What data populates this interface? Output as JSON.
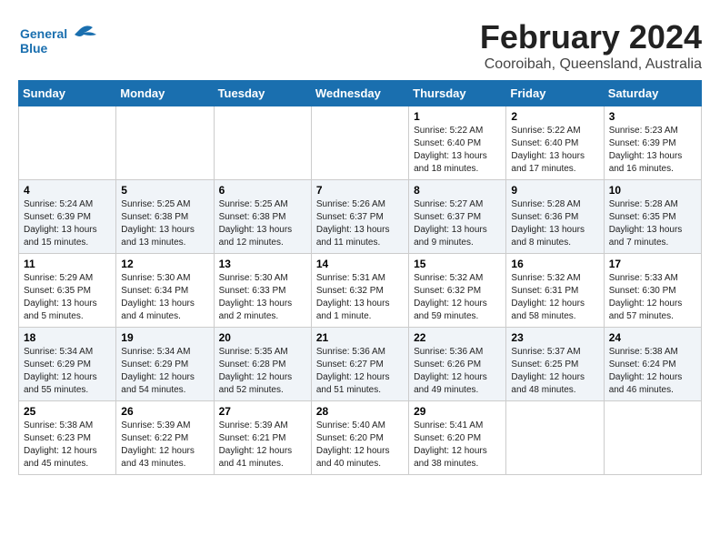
{
  "logo": {
    "line1": "General",
    "line2": "Blue"
  },
  "title": "February 2024",
  "subtitle": "Cooroibah, Queensland, Australia",
  "days_of_week": [
    "Sunday",
    "Monday",
    "Tuesday",
    "Wednesday",
    "Thursday",
    "Friday",
    "Saturday"
  ],
  "weeks": [
    [
      {
        "day": "",
        "detail": ""
      },
      {
        "day": "",
        "detail": ""
      },
      {
        "day": "",
        "detail": ""
      },
      {
        "day": "",
        "detail": ""
      },
      {
        "day": "1",
        "detail": "Sunrise: 5:22 AM\nSunset: 6:40 PM\nDaylight: 13 hours\nand 18 minutes."
      },
      {
        "day": "2",
        "detail": "Sunrise: 5:22 AM\nSunset: 6:40 PM\nDaylight: 13 hours\nand 17 minutes."
      },
      {
        "day": "3",
        "detail": "Sunrise: 5:23 AM\nSunset: 6:39 PM\nDaylight: 13 hours\nand 16 minutes."
      }
    ],
    [
      {
        "day": "4",
        "detail": "Sunrise: 5:24 AM\nSunset: 6:39 PM\nDaylight: 13 hours\nand 15 minutes."
      },
      {
        "day": "5",
        "detail": "Sunrise: 5:25 AM\nSunset: 6:38 PM\nDaylight: 13 hours\nand 13 minutes."
      },
      {
        "day": "6",
        "detail": "Sunrise: 5:25 AM\nSunset: 6:38 PM\nDaylight: 13 hours\nand 12 minutes."
      },
      {
        "day": "7",
        "detail": "Sunrise: 5:26 AM\nSunset: 6:37 PM\nDaylight: 13 hours\nand 11 minutes."
      },
      {
        "day": "8",
        "detail": "Sunrise: 5:27 AM\nSunset: 6:37 PM\nDaylight: 13 hours\nand 9 minutes."
      },
      {
        "day": "9",
        "detail": "Sunrise: 5:28 AM\nSunset: 6:36 PM\nDaylight: 13 hours\nand 8 minutes."
      },
      {
        "day": "10",
        "detail": "Sunrise: 5:28 AM\nSunset: 6:35 PM\nDaylight: 13 hours\nand 7 minutes."
      }
    ],
    [
      {
        "day": "11",
        "detail": "Sunrise: 5:29 AM\nSunset: 6:35 PM\nDaylight: 13 hours\nand 5 minutes."
      },
      {
        "day": "12",
        "detail": "Sunrise: 5:30 AM\nSunset: 6:34 PM\nDaylight: 13 hours\nand 4 minutes."
      },
      {
        "day": "13",
        "detail": "Sunrise: 5:30 AM\nSunset: 6:33 PM\nDaylight: 13 hours\nand 2 minutes."
      },
      {
        "day": "14",
        "detail": "Sunrise: 5:31 AM\nSunset: 6:32 PM\nDaylight: 13 hours\nand 1 minute."
      },
      {
        "day": "15",
        "detail": "Sunrise: 5:32 AM\nSunset: 6:32 PM\nDaylight: 12 hours\nand 59 minutes."
      },
      {
        "day": "16",
        "detail": "Sunrise: 5:32 AM\nSunset: 6:31 PM\nDaylight: 12 hours\nand 58 minutes."
      },
      {
        "day": "17",
        "detail": "Sunrise: 5:33 AM\nSunset: 6:30 PM\nDaylight: 12 hours\nand 57 minutes."
      }
    ],
    [
      {
        "day": "18",
        "detail": "Sunrise: 5:34 AM\nSunset: 6:29 PM\nDaylight: 12 hours\nand 55 minutes."
      },
      {
        "day": "19",
        "detail": "Sunrise: 5:34 AM\nSunset: 6:29 PM\nDaylight: 12 hours\nand 54 minutes."
      },
      {
        "day": "20",
        "detail": "Sunrise: 5:35 AM\nSunset: 6:28 PM\nDaylight: 12 hours\nand 52 minutes."
      },
      {
        "day": "21",
        "detail": "Sunrise: 5:36 AM\nSunset: 6:27 PM\nDaylight: 12 hours\nand 51 minutes."
      },
      {
        "day": "22",
        "detail": "Sunrise: 5:36 AM\nSunset: 6:26 PM\nDaylight: 12 hours\nand 49 minutes."
      },
      {
        "day": "23",
        "detail": "Sunrise: 5:37 AM\nSunset: 6:25 PM\nDaylight: 12 hours\nand 48 minutes."
      },
      {
        "day": "24",
        "detail": "Sunrise: 5:38 AM\nSunset: 6:24 PM\nDaylight: 12 hours\nand 46 minutes."
      }
    ],
    [
      {
        "day": "25",
        "detail": "Sunrise: 5:38 AM\nSunset: 6:23 PM\nDaylight: 12 hours\nand 45 minutes."
      },
      {
        "day": "26",
        "detail": "Sunrise: 5:39 AM\nSunset: 6:22 PM\nDaylight: 12 hours\nand 43 minutes."
      },
      {
        "day": "27",
        "detail": "Sunrise: 5:39 AM\nSunset: 6:21 PM\nDaylight: 12 hours\nand 41 minutes."
      },
      {
        "day": "28",
        "detail": "Sunrise: 5:40 AM\nSunset: 6:20 PM\nDaylight: 12 hours\nand 40 minutes."
      },
      {
        "day": "29",
        "detail": "Sunrise: 5:41 AM\nSunset: 6:20 PM\nDaylight: 12 hours\nand 38 minutes."
      },
      {
        "day": "",
        "detail": ""
      },
      {
        "day": "",
        "detail": ""
      }
    ]
  ]
}
